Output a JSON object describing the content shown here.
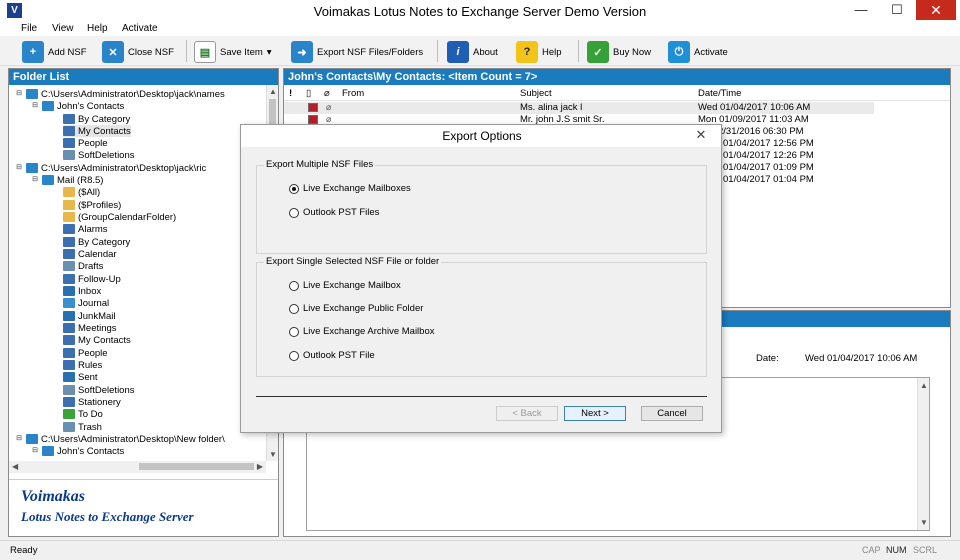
{
  "window": {
    "title": "Voimakas Lotus Notes to Exchange Server Demo Version",
    "minimize": "—",
    "maximize": "☐",
    "close": "✕"
  },
  "menu": [
    "File",
    "View",
    "Help",
    "Activate"
  ],
  "toolbar": {
    "add_nsf": "Add NSF",
    "close_nsf": "Close NSF",
    "save_item": "Save Item",
    "export": "Export NSF Files/Folders",
    "about": "About",
    "help": "Help",
    "buy_now": "Buy Now",
    "activate": "Activate"
  },
  "folder_list": {
    "title": "Folder List",
    "nodes": [
      "C:\\Users\\Administrator\\Desktop\\jack\\names",
      "John's Contacts",
      "By Category",
      "My Contacts",
      "People",
      "SoftDeletions",
      "C:\\Users\\Administrator\\Desktop\\jack\\ric",
      "Mail (R8.5)",
      "($All)",
      "($Profiles)",
      "(GroupCalendarFolder)",
      "Alarms",
      "By Category",
      "Calendar",
      "Drafts",
      "Follow-Up",
      "Inbox",
      "Journal",
      "JunkMail",
      "Meetings",
      "My Contacts",
      "People",
      "Rules",
      "Sent",
      "SoftDeletions",
      "Stationery",
      "To Do",
      "Trash",
      "C:\\Users\\Administrator\\Desktop\\New folder\\",
      "John's Contacts"
    ]
  },
  "brand": {
    "name": "Voimakas",
    "subtitle": "Lotus Notes to Exchange Server"
  },
  "list": {
    "header": "John's Contacts\\My Contacts: <Item Count = 7>",
    "columns": {
      "importance": "!",
      "doc": "",
      "attach": "",
      "from": "From",
      "subject": "Subject",
      "date": "Date/Time"
    },
    "rows": [
      {
        "subject": "Ms. alina jack l",
        "date": "Wed 01/04/2017 10:06 AM"
      },
      {
        "subject": "Mr. john J.S smit Sr.",
        "date": "Mon 01/09/2017 11:03 AM"
      },
      {
        "subject": "",
        "date": "2/31/2016 06:30 PM"
      },
      {
        "subject": "",
        "date": "01/04/2017 12:56 PM"
      },
      {
        "subject": "",
        "date": "01/04/2017 12:26 PM"
      },
      {
        "subject": "",
        "date": "01/04/2017 01:09 PM"
      },
      {
        "subject": "",
        "date": "01/04/2017 01:04 PM"
      }
    ]
  },
  "preview": {
    "date_label": "Date:",
    "date_value": "Wed 01/04/2017 10:06 AM"
  },
  "status": {
    "text": "Ready",
    "cap": "CAP",
    "num": "NUM",
    "scrl": "SCRL"
  },
  "dialog": {
    "title": "Export Options",
    "close": "✕",
    "group_multiple": "Export Multiple NSF Files",
    "multiple_options": [
      "Live Exchange Mailboxes",
      "Outlook PST Files"
    ],
    "selected_multiple": 0,
    "group_single": "Export Single Selected NSF File or folder",
    "single_options": [
      "Live Exchange Mailbox",
      "Live Exchange Public Folder",
      "Live Exchange Archive Mailbox",
      "Outlook PST File"
    ],
    "back": "< Back",
    "next": "Next >",
    "cancel": "Cancel"
  }
}
